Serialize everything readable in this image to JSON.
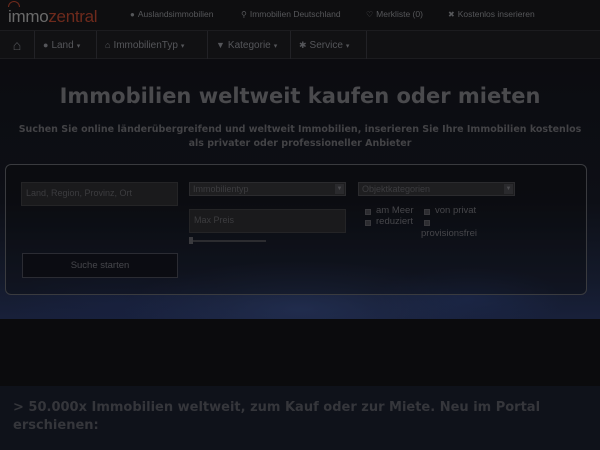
{
  "logo": {
    "part1": "immo",
    "part2": "zentral"
  },
  "toplinks": [
    {
      "icon": "globe-icon",
      "glyph": "●",
      "label": "Auslandsimmobilien"
    },
    {
      "icon": "map-marker-icon",
      "glyph": "⚲",
      "label": "Immobilien Deutschland"
    },
    {
      "icon": "heart-icon",
      "glyph": "♡",
      "label": "Merkliste (0)"
    },
    {
      "icon": "close-icon",
      "glyph": "✖",
      "label": "Kostenlos inserieren"
    }
  ],
  "nav": {
    "home_glyph": "⌂",
    "items": [
      {
        "icon": "globe-icon",
        "glyph": "●",
        "label": "Land"
      },
      {
        "icon": "bank-icon",
        "glyph": "⌂",
        "label": "ImmobilienTyp"
      },
      {
        "icon": "filter-icon",
        "glyph": "▼",
        "label": "Kategorie"
      },
      {
        "icon": "gear-icon",
        "glyph": "✱",
        "label": "Service"
      }
    ]
  },
  "hero": {
    "title": "Immobilien weltweit kaufen oder mieten",
    "subtitle": "Suchen Sie online länderübergreifend und weltweit Immobilien, inserieren Sie Ihre Immobilien kostenlos als privater oder professioneller Anbieter"
  },
  "search": {
    "location_placeholder": "Land, Region, Provinz, Ort",
    "type_selected": "Immobilientyp",
    "category_selected": "Objektkategorien",
    "price_placeholder": "Max Preis",
    "price_slider_value": 0,
    "checkbox_sea": "am Meer",
    "checkbox_reduced": "reduziert",
    "checkbox_private": "von privat",
    "checkbox_commission_free": "provisionsfrei",
    "button_label": "Suche starten"
  },
  "band": {
    "text": "> 50.000x Immobilien weltweit, zum Kauf oder zur Miete. Neu im Portal erschienen:"
  },
  "colors": {
    "logo_accent": "#6e2a1c",
    "band_bg": "#0f121a"
  }
}
